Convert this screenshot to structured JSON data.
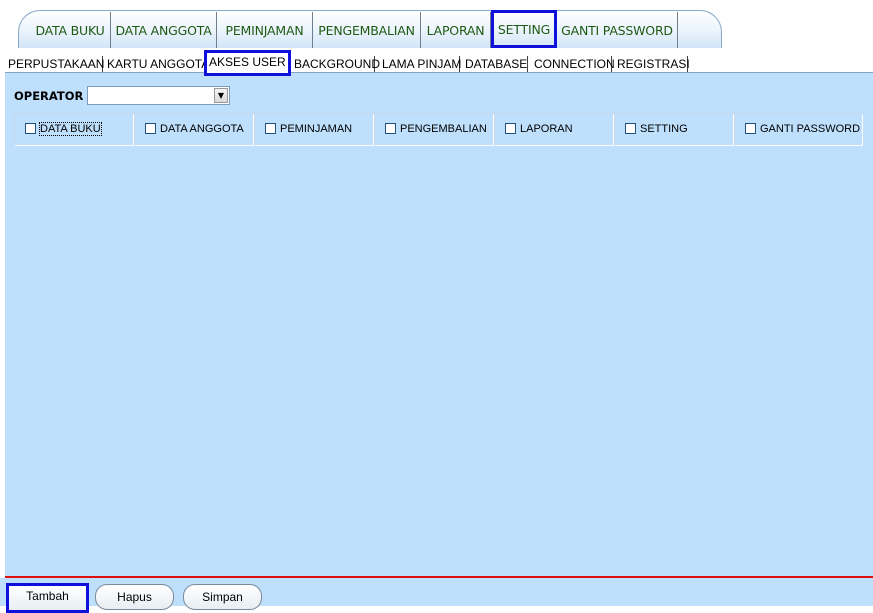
{
  "main_tabs": [
    {
      "label": "DATA BUKU"
    },
    {
      "label": "DATA ANGGOTA"
    },
    {
      "label": "PEMINJAMAN"
    },
    {
      "label": "PENGEMBALIAN"
    },
    {
      "label": "LAPORAN"
    },
    {
      "label": "SETTING",
      "active": true
    },
    {
      "label": "GANTI PASSWORD"
    }
  ],
  "sub_tabs": [
    {
      "label": "PERPUSTAKAAN"
    },
    {
      "label": "KARTU ANGGOTA"
    },
    {
      "label": "AKSES USER",
      "active": true
    },
    {
      "label": "BACKGROUND"
    },
    {
      "label": "LAMA PINJAM"
    },
    {
      "label": "DATABASE"
    },
    {
      "label": "CONNECTION"
    },
    {
      "label": "REGISTRASI"
    }
  ],
  "operator": {
    "label": "OPERATOR",
    "value": ""
  },
  "permissions": [
    {
      "label": "DATA BUKU",
      "checked": false,
      "focused": true
    },
    {
      "label": "DATA ANGGOTA",
      "checked": false
    },
    {
      "label": "PEMINJAMAN",
      "checked": false
    },
    {
      "label": "PENGEMBALIAN",
      "checked": false
    },
    {
      "label": "LAPORAN",
      "checked": false
    },
    {
      "label": "SETTING",
      "checked": false
    },
    {
      "label": "GANTI PASSWORD",
      "checked": false
    }
  ],
  "buttons": {
    "tambah": "Tambah",
    "hapus": "Hapus",
    "simpan": "Simpan"
  },
  "colors": {
    "panel_bg": "#bfe0fd",
    "highlight": "#1010dd",
    "tab_text": "#1f5a14",
    "separator": "#e01010"
  }
}
